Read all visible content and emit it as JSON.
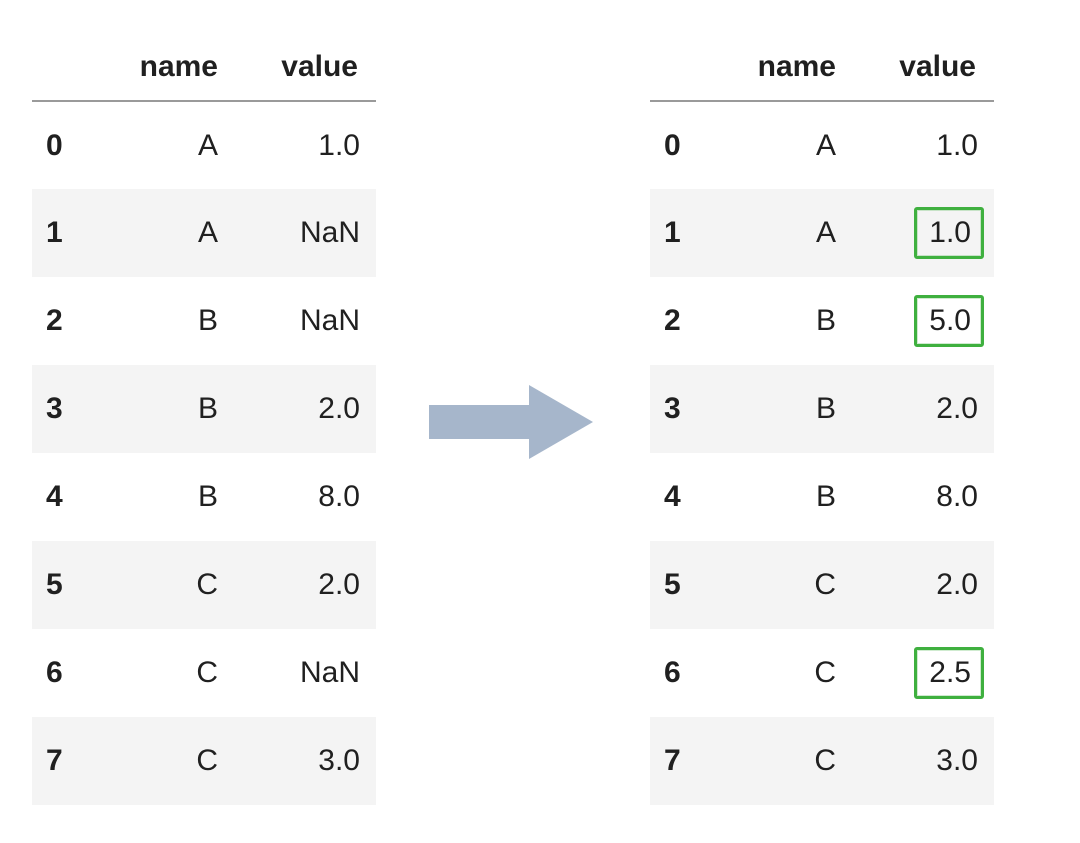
{
  "left_table": {
    "columns": [
      "name",
      "value"
    ],
    "rows": [
      {
        "idx": "0",
        "name": "A",
        "value": "1.0",
        "highlight": false
      },
      {
        "idx": "1",
        "name": "A",
        "value": "NaN",
        "highlight": false
      },
      {
        "idx": "2",
        "name": "B",
        "value": "NaN",
        "highlight": false
      },
      {
        "idx": "3",
        "name": "B",
        "value": "2.0",
        "highlight": false
      },
      {
        "idx": "4",
        "name": "B",
        "value": "8.0",
        "highlight": false
      },
      {
        "idx": "5",
        "name": "C",
        "value": "2.0",
        "highlight": false
      },
      {
        "idx": "6",
        "name": "C",
        "value": "NaN",
        "highlight": false
      },
      {
        "idx": "7",
        "name": "C",
        "value": "3.0",
        "highlight": false
      }
    ]
  },
  "right_table": {
    "columns": [
      "name",
      "value"
    ],
    "rows": [
      {
        "idx": "0",
        "name": "A",
        "value": "1.0",
        "highlight": false
      },
      {
        "idx": "1",
        "name": "A",
        "value": "1.0",
        "highlight": true
      },
      {
        "idx": "2",
        "name": "B",
        "value": "5.0",
        "highlight": true
      },
      {
        "idx": "3",
        "name": "B",
        "value": "2.0",
        "highlight": false
      },
      {
        "idx": "4",
        "name": "B",
        "value": "8.0",
        "highlight": false
      },
      {
        "idx": "5",
        "name": "C",
        "value": "2.0",
        "highlight": false
      },
      {
        "idx": "6",
        "name": "C",
        "value": "2.5",
        "highlight": true
      },
      {
        "idx": "7",
        "name": "C",
        "value": "3.0",
        "highlight": false
      }
    ]
  },
  "arrow": {
    "color": "#a6b6cb",
    "direction": "right"
  },
  "highlight_color": "#3fb03f"
}
